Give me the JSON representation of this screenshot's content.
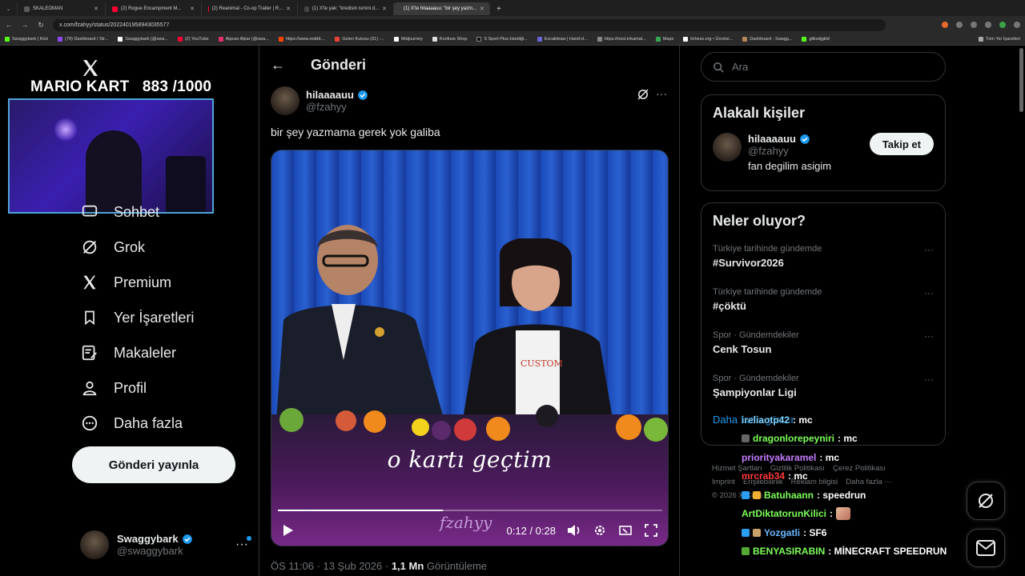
{
  "browser": {
    "tabs": [
      {
        "label": "SKALEOMAN",
        "color": "#5b5b5b",
        "active": false
      },
      {
        "label": "(2) Rogue Encampment M...",
        "color": "#ff0033",
        "active": false
      },
      {
        "label": "(2) Reanimal - Co-op Trailer | R...",
        "color": "#ff0033",
        "active": false
      },
      {
        "label": "(1) X'te yak: \"kredisin ismini d...",
        "color": "#444444",
        "active": false
      },
      {
        "label": "(1) X'te hilaaaauu: \"bir şey yazm...",
        "color": "#444444",
        "active": true
      }
    ],
    "url": "x.com/fzahyy/status/2022401958943035577",
    "bookmarks": [
      "Swaggybark | Kick",
      "(79) Dashboard / Str...",
      "Swaggybark (@swa...",
      "(2) YouTube",
      "Alpcan Alpar (@swa...",
      "https://www.reddit....",
      "Gelen Kutusu (31) -...",
      "Midjourney",
      "Konfuse Shop",
      "S Sport Plus-İstediği...",
      "Excalidraw | Hand-d...",
      "https://nest.inkamat...",
      "Maps",
      "lichess.org • Ücretsi...",
      "Dashboard - Swagg...",
      "gliksdjgkld"
    ],
    "all_bookmarks": "Tüm Yer İşaretleri"
  },
  "overlay": {
    "title": "MARIO KART",
    "counter": "883 /1000"
  },
  "nav": {
    "items": [
      {
        "label": "Sohbet",
        "icon": "chat-icon"
      },
      {
        "label": "Grok",
        "icon": "grok-icon"
      },
      {
        "label": "Premium",
        "icon": "x-premium-icon"
      },
      {
        "label": "Yer İşaretleri",
        "icon": "bookmark-icon"
      },
      {
        "label": "Makaleler",
        "icon": "article-icon"
      },
      {
        "label": "Profil",
        "icon": "profile-icon"
      },
      {
        "label": "Daha fazla",
        "icon": "more-circle-icon"
      }
    ],
    "post_button": "Gönderi yayınla",
    "user": {
      "name": "Swaggybark",
      "handle": "@swaggybark"
    }
  },
  "main": {
    "header_title": "Gönderi",
    "author": {
      "name": "hilaaaauu",
      "handle": "@fzahyy"
    },
    "text": "bir şey yazmama gerek yok galiba",
    "video": {
      "caption": "o kartı geçtim",
      "watermark": "fzahyy",
      "time": "0:12 / 0:28",
      "progress": 0.43
    },
    "meta": {
      "time": "ÖS 11:06 · 13 Şub 2026 · ",
      "views": "1,1 Mn",
      "views_label": " Görüntüleme"
    }
  },
  "right": {
    "search_placeholder": "Ara",
    "related": {
      "title": "Alakalı kişiler",
      "name": "hilaaaauu",
      "handle": "@fzahyy",
      "bio": "fan degilim asigim",
      "follow": "Takip et"
    },
    "trends": {
      "title": "Neler oluyor?",
      "items": [
        {
          "context": "Türkiye tarihinde gündemde",
          "name": "#Survivor2026"
        },
        {
          "context": "Türkiye tarihinde gündemde",
          "name": "#çöktü"
        },
        {
          "context": "Spor · Gündemdekiler",
          "name": "Cenk Tosun"
        },
        {
          "context": "Spor · Gündemdekiler",
          "name": "Şampiyonlar Ligi"
        }
      ],
      "show_more": "Daha fazla göster"
    },
    "footer": [
      "Hizmet Şartları",
      "Gizlilik Politikası",
      "Çerez Politikası",
      "Imprint",
      "Erişilebilirlik",
      "Reklam bilgisi",
      "Daha fazla ···",
      "© 2026 X Corp."
    ]
  },
  "chat": [
    {
      "user": "ireliaotp42",
      "msg": " : mc",
      "color": "#7fd3ff",
      "badge": ""
    },
    {
      "user": "dragonlorepeyniri",
      "msg": " : mc",
      "color": "#7dff5a",
      "badge": "#666666"
    },
    {
      "user": "priorityakaramel",
      "msg": " : mc",
      "color": "#c77dff",
      "badge": ""
    },
    {
      "user": "mrcrab34",
      "msg": " : mc",
      "color": "#ff3b3b",
      "badge": ""
    },
    {
      "user": "Batuhaann",
      "msg": " : speedrun",
      "color": "#7dff5a",
      "badge": "#2a9df4"
    },
    {
      "user": "ArtDiktatorunKilici",
      "msg": " : ",
      "color": "#7dff5a",
      "badge": "",
      "emote": true
    },
    {
      "user": "Yozgatli",
      "msg": " : SF6",
      "color": "#6ab7ff",
      "badge": "#2a9df4"
    },
    {
      "user": "BENYASIRABIN",
      "msg": " : MİNECRAFT SPEEDRUN",
      "color": "#7dff5a",
      "badge": "#55aa33"
    }
  ]
}
